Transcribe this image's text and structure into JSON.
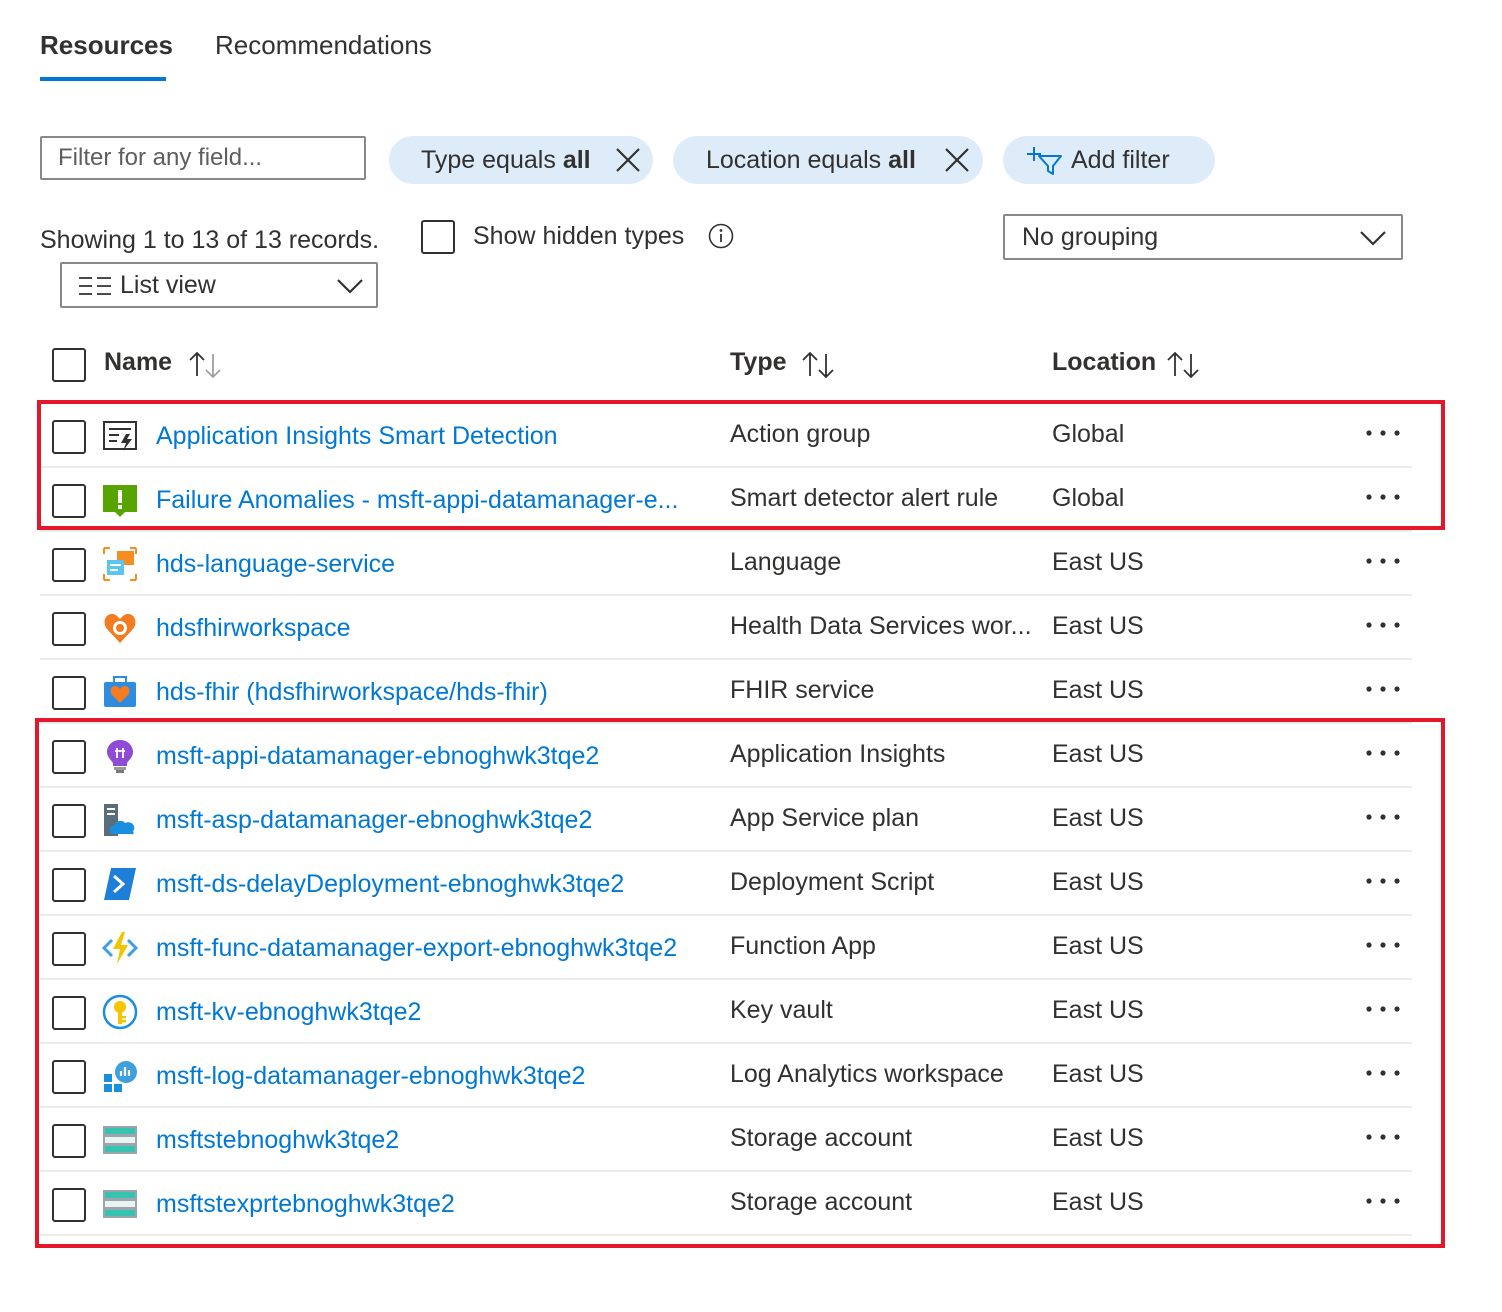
{
  "tabs": [
    {
      "label": "Resources"
    },
    {
      "label": "Recommendations"
    }
  ],
  "filter": {
    "placeholder": "Filter for any field...",
    "pills": [
      {
        "prefix": "Type equals",
        "value": "all"
      },
      {
        "prefix": "Location equals",
        "value": "all"
      }
    ],
    "add_filter_label": "Add filter"
  },
  "summary": "Showing 1 to 13 of 13 records.",
  "show_hidden_label": "Show hidden types",
  "grouping": {
    "selected": "No grouping"
  },
  "view": {
    "selected": "List view"
  },
  "columns": {
    "name": "Name",
    "type": "Type",
    "location": "Location"
  },
  "rows": [
    {
      "name": "Application Insights Smart Detection",
      "type": "Action group",
      "location": "Global",
      "icon": "action-group-icon"
    },
    {
      "name": "Failure Anomalies - msft-appi-datamanager-e...",
      "type": "Smart detector alert rule",
      "location": "Global",
      "icon": "smart-detector-alert-icon"
    },
    {
      "name": "hds-language-service",
      "type": "Language",
      "location": "East US",
      "icon": "language-service-icon"
    },
    {
      "name": "hdsfhirworkspace",
      "type": "Health Data Services wor...",
      "location": "East US",
      "icon": "health-data-services-icon"
    },
    {
      "name": "hds-fhir (hdsfhirworkspace/hds-fhir)",
      "type": "FHIR service",
      "location": "East US",
      "icon": "fhir-service-icon"
    },
    {
      "name": "msft-appi-datamanager-ebnoghwk3tqe2",
      "type": "Application Insights",
      "location": "East US",
      "icon": "application-insights-icon"
    },
    {
      "name": "msft-asp-datamanager-ebnoghwk3tqe2",
      "type": "App Service plan",
      "location": "East US",
      "icon": "app-service-plan-icon"
    },
    {
      "name": "msft-ds-delayDeployment-ebnoghwk3tqe2",
      "type": "Deployment Script",
      "location": "East US",
      "icon": "deployment-script-icon"
    },
    {
      "name": "msft-func-datamanager-export-ebnoghwk3tqe2",
      "type": "Function App",
      "location": "East US",
      "icon": "function-app-icon"
    },
    {
      "name": "msft-kv-ebnoghwk3tqe2",
      "type": "Key vault",
      "location": "East US",
      "icon": "key-vault-icon"
    },
    {
      "name": "msft-log-datamanager-ebnoghwk3tqe2",
      "type": "Log Analytics workspace",
      "location": "East US",
      "icon": "log-analytics-icon"
    },
    {
      "name": "msftstebnoghwk3tqe2",
      "type": "Storage account",
      "location": "East US",
      "icon": "storage-account-icon"
    },
    {
      "name": "msftstexprtebnoghwk3tqe2",
      "type": "Storage account",
      "location": "East US",
      "icon": "storage-account-icon"
    }
  ],
  "colors": {
    "accent": "#0078d4",
    "pill_bg": "#deecf9",
    "highlight": "#e3182d"
  }
}
